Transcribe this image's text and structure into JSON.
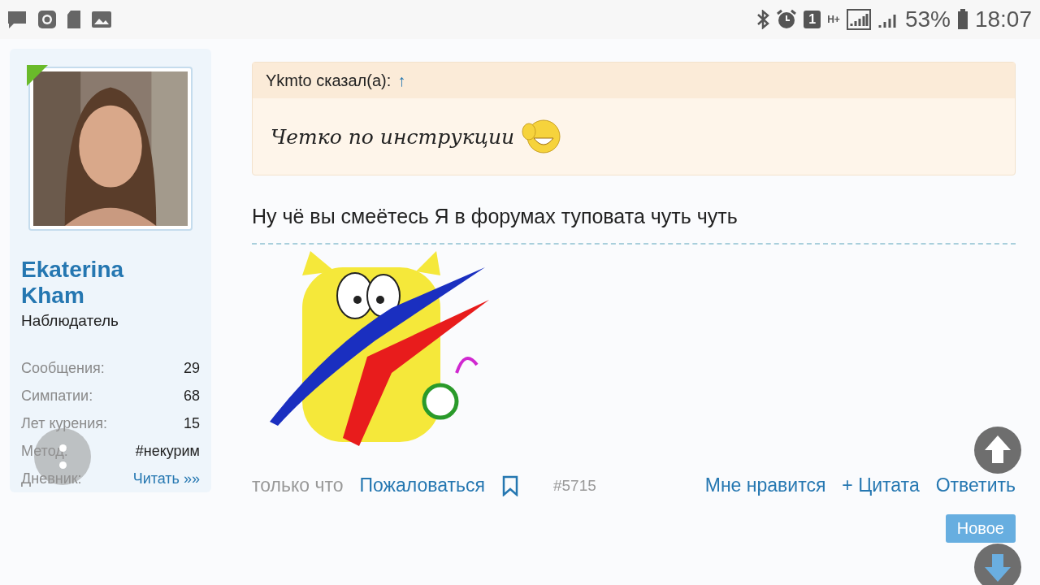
{
  "status_bar": {
    "sim": "1",
    "network": "H+",
    "battery": "53%",
    "time": "18:07"
  },
  "author": {
    "name": "Ekaterina Kham",
    "rank": "Наблюдатель",
    "stats": [
      {
        "label": "Сообщения:",
        "value": "29",
        "kind": "text"
      },
      {
        "label": "Симпатии:",
        "value": "68",
        "kind": "text"
      },
      {
        "label": "Лет курения:",
        "value": "15",
        "kind": "text"
      },
      {
        "label": "Метод:",
        "value": "#некурим",
        "kind": "text"
      },
      {
        "label": "Дневник:",
        "value": "Читать »»",
        "kind": "link"
      }
    ]
  },
  "quote": {
    "author": "Ykmto сказал(а):",
    "arrow": "↑",
    "text": "Четко по инструкции"
  },
  "post": {
    "text": "Ну чё вы смеётесь Я в форумах туповата чуть чуть",
    "date": "только что",
    "report": "Пожаловаться",
    "number": "#5715",
    "actions": [
      "Мне нравится",
      "+ Цитата",
      "Ответить"
    ]
  },
  "new_button": "Новое"
}
